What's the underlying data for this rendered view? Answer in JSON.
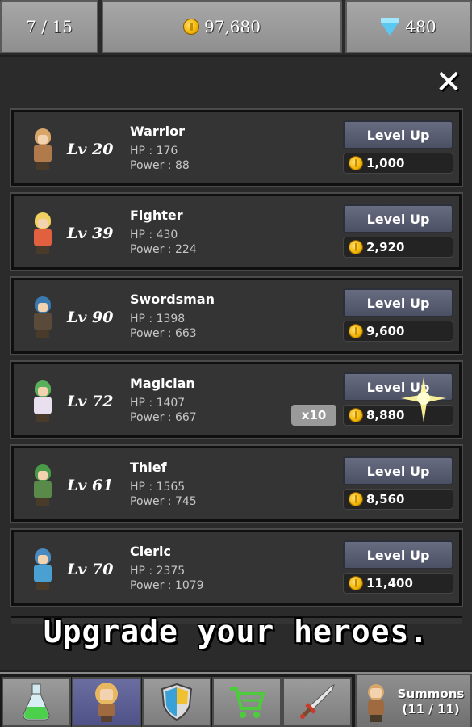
{
  "top_bar": {
    "stage": "7 / 15",
    "gold": "97,680",
    "gems": "480"
  },
  "close_icon": "close-icon",
  "heroes": [
    {
      "name": "Warrior",
      "level": "Lv 20",
      "hp": "HP : 176",
      "power": "Power : 88",
      "button": "Level Up",
      "cost": "1,000",
      "hair": "#d9a66a",
      "outfit": "#b07a4a"
    },
    {
      "name": "Fighter",
      "level": "Lv 39",
      "hp": "HP : 430",
      "power": "Power : 224",
      "button": "Level Up",
      "cost": "2,920",
      "hair": "#f0d060",
      "outfit": "#e06040"
    },
    {
      "name": "Swordsman",
      "level": "Lv 90",
      "hp": "HP : 1398",
      "power": "Power : 663",
      "button": "Level Up",
      "cost": "9,600",
      "hair": "#3a7ab0",
      "outfit": "#5a4a3a"
    },
    {
      "name": "Magician",
      "level": "Lv 72",
      "hp": "HP : 1407",
      "power": "Power : 667",
      "button": "Level Up",
      "cost": "8,880",
      "multiplier": "x10",
      "hair": "#5ab05a",
      "outfit": "#e8e0ef"
    },
    {
      "name": "Thief",
      "level": "Lv 61",
      "hp": "HP : 1565",
      "power": "Power : 745",
      "button": "Level Up",
      "cost": "8,560",
      "hair": "#4a9a4a",
      "outfit": "#5a8a4a"
    },
    {
      "name": "Cleric",
      "level": "Lv 70",
      "hp": "HP : 2375",
      "power": "Power : 1079",
      "button": "Level Up",
      "cost": "11,400",
      "hair": "#4a8ac0",
      "outfit": "#4aa0d0"
    }
  ],
  "tagline": "Upgrade your heroes.",
  "bottom_tabs": [
    {
      "icon": "potion-icon"
    },
    {
      "icon": "hero-icon"
    },
    {
      "icon": "shield-icon"
    },
    {
      "icon": "cart-icon"
    },
    {
      "icon": "sword-icon"
    }
  ],
  "summons": {
    "label": "Summons",
    "count": "(11 / 11)"
  }
}
